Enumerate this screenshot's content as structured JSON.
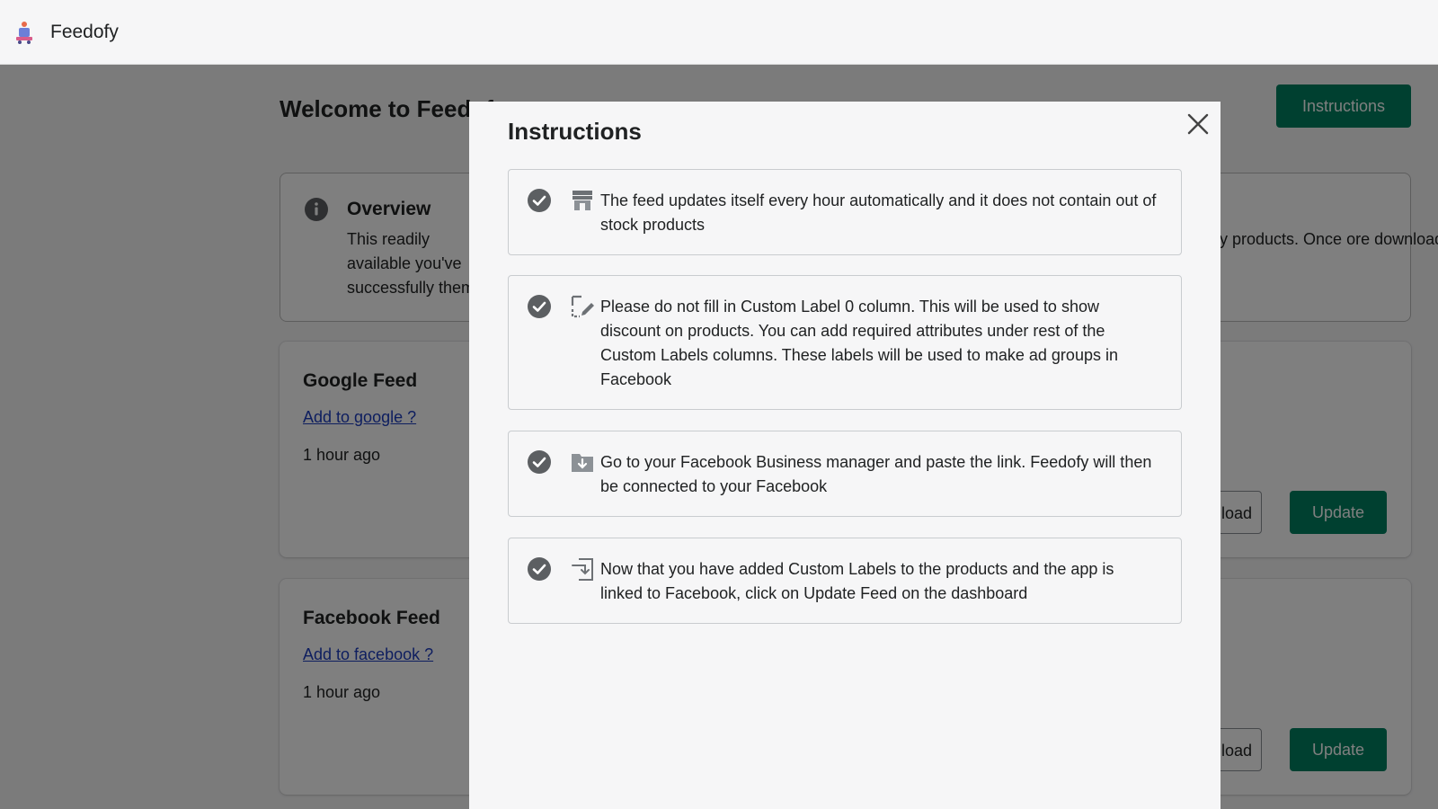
{
  "app": {
    "name": "Feedofy"
  },
  "page": {
    "title": "Welcome to Feedofy",
    "instructions_button": "Instructions",
    "overview": {
      "title": "Overview",
      "text_left": "This readily available you've successfully them.",
      "text_right": "fy products. Once ore downloading"
    },
    "feeds": [
      {
        "title": "Google Feed",
        "link": "Add to google ?",
        "time": "1 hour ago",
        "download_label": "nload",
        "update_label": "Update"
      },
      {
        "title": "Facebook Feed",
        "link": "Add to facebook ?",
        "time": "1 hour ago",
        "download_label": "nload",
        "update_label": "Update"
      }
    ]
  },
  "modal": {
    "title": "Instructions",
    "items": [
      {
        "icon": "store-icon",
        "text": "The feed updates itself every hour automatically and it does not contain out of stock products"
      },
      {
        "icon": "edit-label-icon",
        "text": "Please do not fill in Custom Label 0 column. This will be used to show discount on products. You can add required attributes under rest of the Custom Labels columns. These labels will be used to make ad groups in Facebook"
      },
      {
        "icon": "download-folder-icon",
        "text": "Go to your Facebook Business manager and paste the link. Feedofy will then be connected to your Facebook"
      },
      {
        "icon": "import-icon",
        "text": "Now that you have added Custom Labels to the products and the app is linked to Facebook, click on Update Feed on the dashboard"
      }
    ]
  },
  "colors": {
    "primary": "#008060",
    "overlay": "rgba(0,0,0,0.5)",
    "link": "#1d3dbf"
  }
}
